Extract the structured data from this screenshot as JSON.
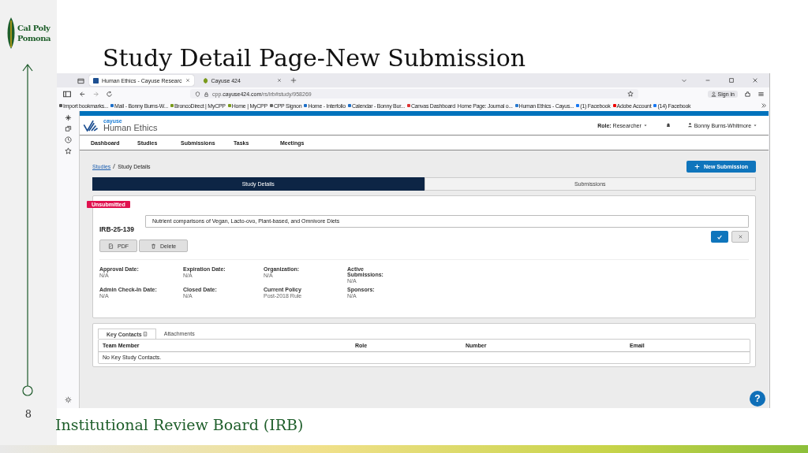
{
  "slide": {
    "title": "Study Detail Page-New Submission",
    "page_number": "8",
    "footer": "Institutional Review Board (IRB)",
    "logo": {
      "line1": "Cal Poly",
      "line2": "Pomona"
    }
  },
  "browser": {
    "tabs": [
      {
        "label": "Human Ethics - Cayuse Researc",
        "selected": true
      },
      {
        "label": "Cayuse 424",
        "selected": false
      }
    ],
    "url_plain": "cpp.",
    "url_bold": "cayuse424.com",
    "url_rest": "/rs/irb#study/958269",
    "sign_in": "Sign in",
    "bookmarks": [
      {
        "label": "Import bookmarks...",
        "kind": "import"
      },
      {
        "label": "Mail - Bonny Burns-W...",
        "kind": "mail"
      },
      {
        "label": "BroncoDirect | MyCPP",
        "kind": "leaf"
      },
      {
        "label": "Home | MyCPP",
        "kind": "leaf"
      },
      {
        "label": "CPP Signon",
        "kind": "ring"
      },
      {
        "label": "Home - Interfolio",
        "kind": "info"
      },
      {
        "label": "Calendar - Bonny Bur...",
        "kind": "mail"
      },
      {
        "label": "Canvas Dashboard",
        "kind": "canvas"
      },
      {
        "label": "Home Page: Journal o...",
        "kind": "none"
      },
      {
        "label": "Human Ethics - Cayus...",
        "kind": "flag"
      },
      {
        "label": "(1) Facebook",
        "kind": "facebook"
      },
      {
        "label": "Adobe Account",
        "kind": "adobe"
      },
      {
        "label": "(14) Facebook",
        "kind": "facebook"
      }
    ]
  },
  "app": {
    "brand_small": "cayuse",
    "brand": "Human Ethics",
    "role_label": "Role:",
    "role": "Researcher",
    "user": "Bonny Burns-Whitmore",
    "nav": [
      "Dashboard",
      "Studies",
      "Submissions",
      "Tasks",
      "Meetings"
    ],
    "breadcrumb": [
      {
        "label": "Studies",
        "kind": "link"
      },
      {
        "label": "Study Details",
        "kind": "current"
      }
    ],
    "new_submission": "New Submission",
    "detail_tabs": [
      {
        "label": "Study Details",
        "selected": true
      },
      {
        "label": "Submissions",
        "selected": false
      }
    ],
    "study": {
      "status": "Unsubmitted",
      "id": "IRB-25-139",
      "title_value": "Nutrient comparisons of Vegan, Lacto-ovo, Plant-based, and Omnivore Diets",
      "buttons": [
        {
          "label": "PDF",
          "kind": "pdf"
        },
        {
          "label": "Delete",
          "kind": "delete"
        }
      ]
    },
    "fields": [
      {
        "label": "Approval Date:",
        "value": "N/A"
      },
      {
        "label": "Expiration Date:",
        "value": "N/A"
      },
      {
        "label": "Organization:",
        "value": "N/A"
      },
      {
        "label": "Active Submissions:",
        "value": "N/A"
      },
      {
        "label": "Admin Check-In Date:",
        "value": "N/A"
      },
      {
        "label": "Closed Date:",
        "value": "N/A"
      },
      {
        "label": "Current Policy",
        "value": "Post-2018 Rule"
      },
      {
        "label": "Sponsors:",
        "value": "N/A"
      }
    ],
    "contact_tabs": [
      {
        "label": "Key Contacts",
        "selected": true
      },
      {
        "label": "Attachments",
        "selected": false
      }
    ],
    "contacts": {
      "columns": [
        "Team Member",
        "Role",
        "Number",
        "Email"
      ],
      "empty": "No Key Study Contacts."
    },
    "help": "?"
  }
}
